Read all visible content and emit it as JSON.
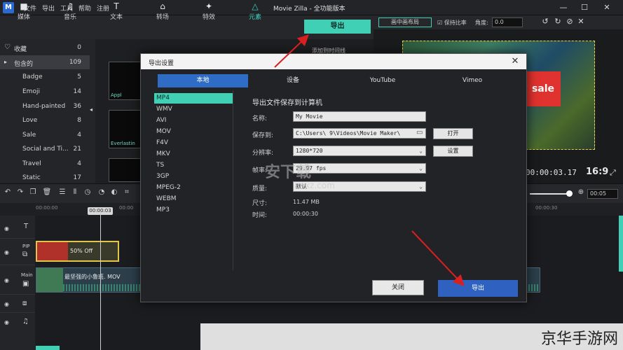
{
  "app": {
    "logo": "M",
    "title": "Movie Zilla - 全功能版本",
    "menu": [
      "文件",
      "导出",
      "工具",
      "帮助",
      "注册"
    ],
    "window_controls": [
      "—",
      "☐",
      "✕"
    ]
  },
  "toolbar": {
    "items": [
      {
        "label": "媒体",
        "icon": "folder-icon",
        "glyph": "■"
      },
      {
        "label": "音乐",
        "icon": "music-icon",
        "glyph": "♫"
      },
      {
        "label": "文本",
        "icon": "text-icon",
        "glyph": "T"
      },
      {
        "label": "转场",
        "icon": "transition-icon",
        "glyph": "⌂"
      },
      {
        "label": "特效",
        "icon": "effects-icon",
        "glyph": "✦"
      },
      {
        "label": "元素",
        "icon": "elements-icon",
        "glyph": "△"
      }
    ],
    "active_index": 5,
    "export_label": "导出",
    "add_to_timeline": "添加到时间线"
  },
  "sidebar": {
    "items": [
      {
        "label": "收藏",
        "count": "0",
        "icon": "heart-icon",
        "top": true
      },
      {
        "label": "包含的",
        "count": "109",
        "icon": "folder-icon",
        "top": true,
        "selected": true
      },
      {
        "label": "Badge",
        "count": "5"
      },
      {
        "label": "Emoji",
        "count": "14"
      },
      {
        "label": "Hand-painted",
        "count": "36"
      },
      {
        "label": "Love",
        "count": "8"
      },
      {
        "label": "Sale",
        "count": "4"
      },
      {
        "label": "Social and Ti...",
        "count": "21"
      },
      {
        "label": "Travel",
        "count": "4"
      },
      {
        "label": "Static",
        "count": "17"
      }
    ],
    "thumbs": [
      {
        "caption": "Appl"
      },
      {
        "caption": "Everlastin"
      },
      {
        "caption": ""
      }
    ]
  },
  "preview": {
    "layout_button": "画中画布局",
    "keep_ratio": "☑ 保持比率",
    "angle_label": "角度:",
    "angle_value": "0.0",
    "sale_text": "sale",
    "timecode": "00:00:03.17",
    "aspect": "16:9"
  },
  "timeline": {
    "zoom": "00:05",
    "ticks": [
      "00:00:00",
      "00:00:03",
      "00:00",
      "00:00:30"
    ],
    "playhead": "00:00:03",
    "tracks": [
      {
        "label": "",
        "icon": "text-icon"
      },
      {
        "label": "PIP",
        "icon": "pip-icon"
      },
      {
        "label": "Main",
        "icon": "video-icon"
      },
      {
        "label": "",
        "icon": "overlay-icon"
      },
      {
        "label": "",
        "icon": "music-icon"
      }
    ],
    "pip_clip": "50% Off",
    "main_clip": "最坚强的小鲁班. MOV"
  },
  "dialog": {
    "title": "导出设置",
    "close": "✕",
    "tabs": [
      "本地",
      "设备",
      "YouTube",
      "Vimeo"
    ],
    "active_tab": 0,
    "formats": [
      "MP4",
      "WMV",
      "AVI",
      "MOV",
      "F4V",
      "MKV",
      "TS",
      "3GP",
      "MPEG-2",
      "WEBM",
      "MP3"
    ],
    "selected_format": 0,
    "heading": "导出文件保存到计算机",
    "fields": {
      "name_label": "名称:",
      "name_value": "My Movie",
      "save_label": "保存到:",
      "save_value": "C:\\Users\\    9\\Videos\\Movie Maker\\",
      "open_button": "打开",
      "resolution_label": "分辨率:",
      "resolution_value": "1280*720",
      "settings_button": "设置",
      "framerate_label": "帧率:",
      "framerate_value": "29.97 fps",
      "quality_label": "质量:",
      "quality_value": "默认",
      "size_label": "尺寸:",
      "size_value": "11.47 MB",
      "time_label": "时间:",
      "time_value": "00:00:30"
    },
    "close_button": "关闭",
    "export_button": "导出"
  },
  "watermark": {
    "main": "安下载",
    "sub": "anxz.com",
    "corner": "京华手游网"
  },
  "colors": {
    "accent": "#3fd0b6",
    "dialog_primary": "#2f62c0",
    "arrow": "#d92020"
  }
}
